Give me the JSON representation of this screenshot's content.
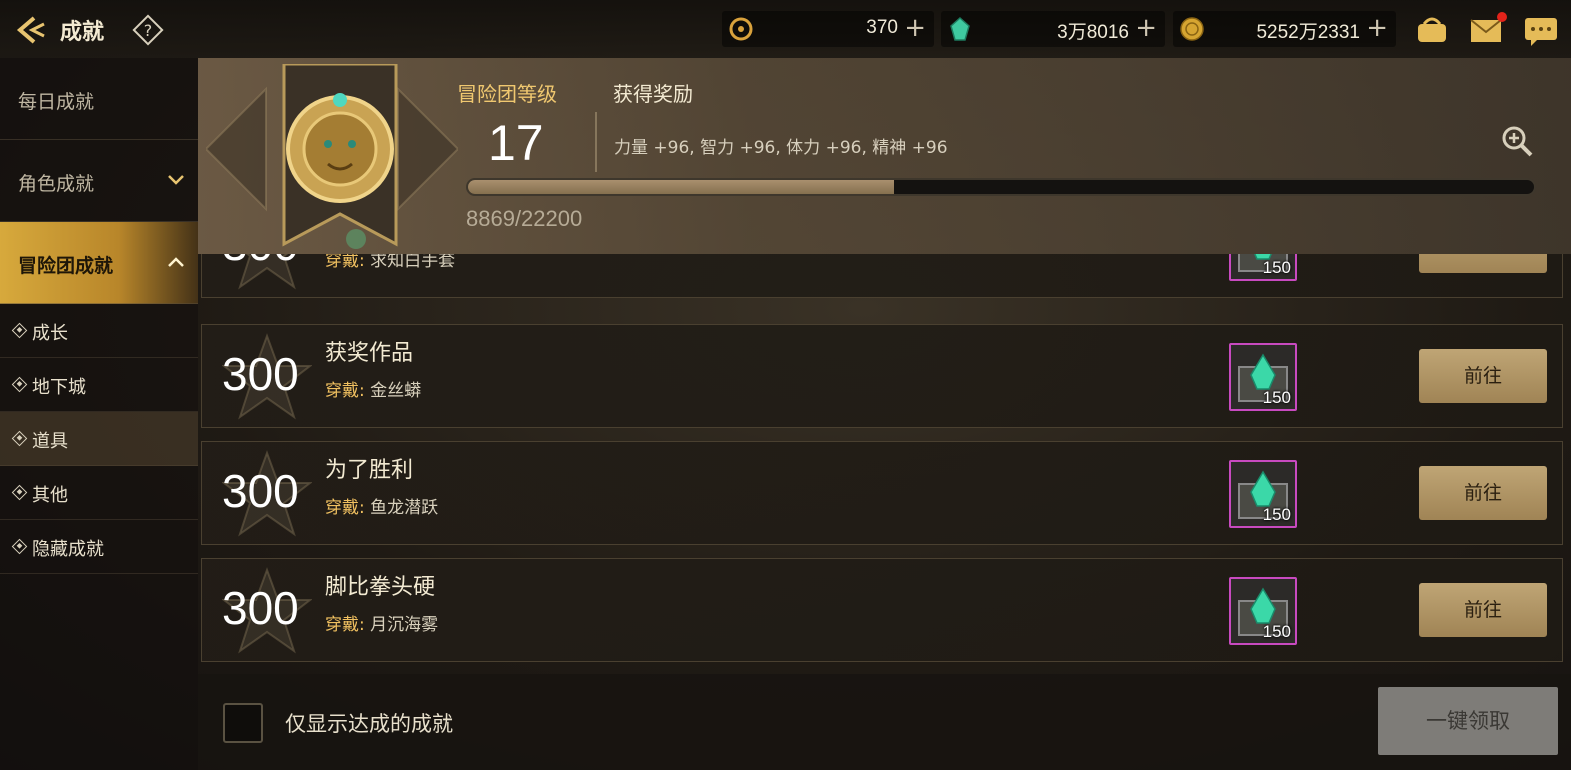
{
  "header": {
    "title": "成就",
    "currencies": [
      {
        "icon": "fatigue-coin-icon",
        "value": "370"
      },
      {
        "icon": "green-gem-icon",
        "value": "3万8016"
      },
      {
        "icon": "gold-coin-icon",
        "value": "5252万2331"
      }
    ],
    "plus": "+"
  },
  "sidebar": {
    "main": [
      "每日成就",
      "角色成就",
      "冒险团成就"
    ],
    "sub": [
      "成长",
      "地下城",
      "道具",
      "其他",
      "隐藏成就"
    ],
    "active_main": "冒险团成就",
    "active_sub": "道具"
  },
  "adventure": {
    "level_label": "冒险团等级",
    "level": "17",
    "reward_label": "获得奖励",
    "reward_text": "力量 +96, 智力 +96, 体力 +96, 精神 +96",
    "progress_text": "8869/22200",
    "progress_fraction": 0.3995
  },
  "wear_key": "穿戴:",
  "rows": [
    {
      "points": "300",
      "name": "",
      "wear": "求知白手套",
      "reward_count": "150",
      "button": "前往"
    },
    {
      "points": "300",
      "name": "获奖作品",
      "wear": "金丝蟒",
      "reward_count": "150",
      "button": "前往"
    },
    {
      "points": "300",
      "name": "为了胜利",
      "wear": "鱼龙潜跃",
      "reward_count": "150",
      "button": "前往"
    },
    {
      "points": "300",
      "name": "脚比拳头硬",
      "wear": "月沉海雾",
      "reward_count": "150",
      "button": "前往"
    }
  ],
  "bottom": {
    "only_done_label": "仅显示达成的成就",
    "claim_all": "一键领取"
  },
  "colors": {
    "gold_accent": "#d7a93c",
    "reward_border": "#c84ac0",
    "button_gold": "#b09468"
  }
}
